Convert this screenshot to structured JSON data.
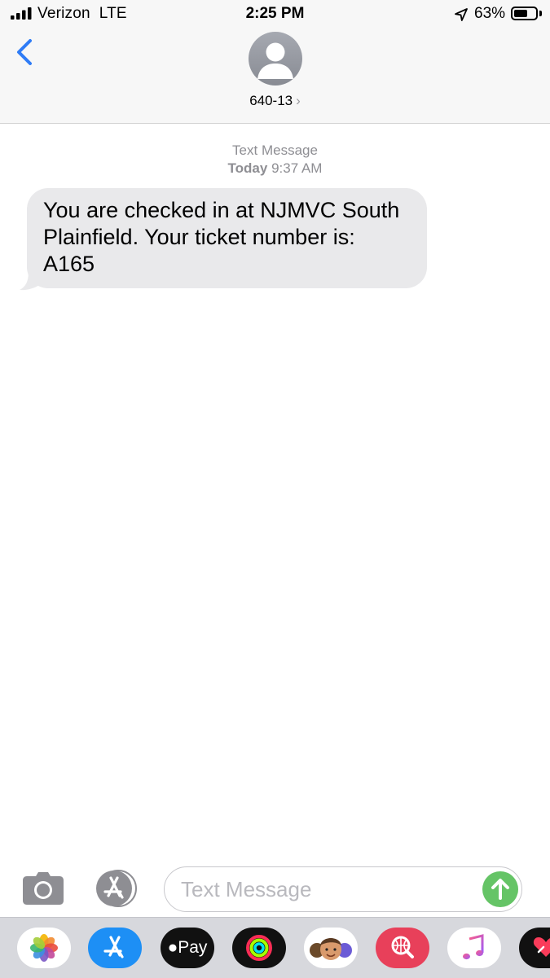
{
  "status_bar": {
    "carrier": "Verizon",
    "network": "LTE",
    "time": "2:25 PM",
    "battery_percent": "63%",
    "battery_level": 0.63,
    "icons": [
      "signal-bars-icon",
      "location-arrow-icon",
      "battery-icon"
    ]
  },
  "header": {
    "contact_name": "640-13",
    "chevron": "›",
    "icons": [
      "back-chevron-icon",
      "contact-avatar-icon"
    ]
  },
  "thread": {
    "service_label": "Text Message",
    "date_label": "Today",
    "time_label": "9:37 AM",
    "messages": [
      {
        "direction": "incoming",
        "lines": [
          "You are checked in at NJMVC South",
          "Plainfield. Your ticket number is:",
          "A165"
        ]
      }
    ]
  },
  "composer": {
    "placeholder": "Text Message",
    "value": "",
    "icons": [
      "camera-icon",
      "app-store-icon",
      "send-arrow-icon"
    ]
  },
  "app_drawer": {
    "apps": [
      {
        "name": "photos",
        "icon": "photos-icon"
      },
      {
        "name": "app-store",
        "icon": "app-store-icon"
      },
      {
        "name": "apple-pay",
        "icon": "apple-pay-icon",
        "label": "Pay"
      },
      {
        "name": "activity",
        "icon": "activity-rings-icon"
      },
      {
        "name": "memoji",
        "icon": "memoji-icon"
      },
      {
        "name": "images",
        "icon": "image-search-icon"
      },
      {
        "name": "music",
        "icon": "music-note-icon"
      },
      {
        "name": "digital-touch",
        "icon": "digital-touch-icon"
      }
    ]
  },
  "colors": {
    "accent_blue": "#2f7cf6",
    "bubble_gray": "#e9e9eb",
    "send_green": "#65c466",
    "bar_background": "#f7f7f7",
    "drawer_background": "#d7d8dd"
  }
}
